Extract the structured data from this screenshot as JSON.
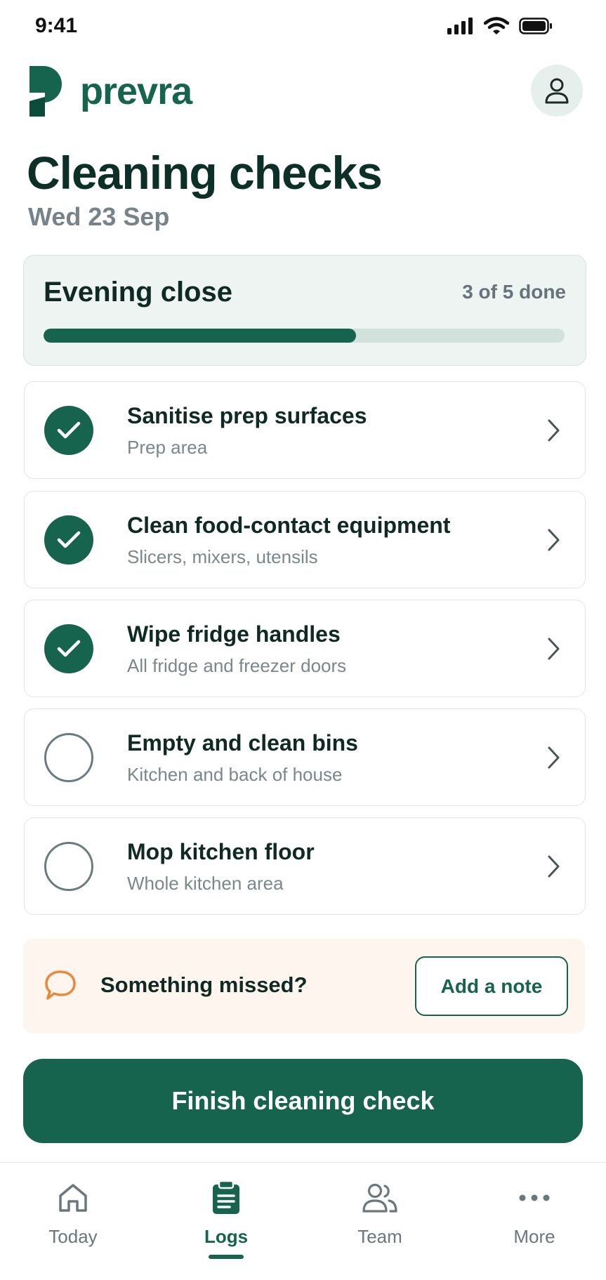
{
  "status_bar": {
    "time": "9:41"
  },
  "app": {
    "name": "prevra"
  },
  "page": {
    "title": "Cleaning checks",
    "date": "Wed 23 Sep"
  },
  "checklist": {
    "name": "Evening close",
    "progress_text": "3 of 5 done",
    "completed": 3,
    "total": 5
  },
  "tasks": [
    {
      "title": "Sanitise prep surfaces",
      "subtitle": "Prep area",
      "done": true
    },
    {
      "title": "Clean food-contact equipment",
      "subtitle": "Slicers, mixers, utensils",
      "done": true
    },
    {
      "title": "Wipe fridge handles",
      "subtitle": "All fridge and freezer doors",
      "done": true
    },
    {
      "title": "Empty and clean bins",
      "subtitle": "Kitchen and back of house",
      "done": false
    },
    {
      "title": "Mop kitchen floor",
      "subtitle": "Whole kitchen area",
      "done": false
    }
  ],
  "note": {
    "prompt": "Something missed?",
    "button_label": "Add a note"
  },
  "actions": {
    "finish_label": "Finish cleaning check"
  },
  "nav": {
    "active": "logs",
    "items": [
      {
        "id": "today",
        "label": "Today",
        "icon": "home-icon"
      },
      {
        "id": "logs",
        "label": "Logs",
        "icon": "clipboard-icon"
      },
      {
        "id": "team",
        "label": "Team",
        "icon": "people-icon"
      },
      {
        "id": "more",
        "label": "More",
        "icon": "more-icon"
      }
    ]
  },
  "colors": {
    "brand": "#17644e",
    "brand_light": "#eef4f2",
    "note_bg": "#fdf5ee",
    "note_icon": "#e88a3a"
  }
}
